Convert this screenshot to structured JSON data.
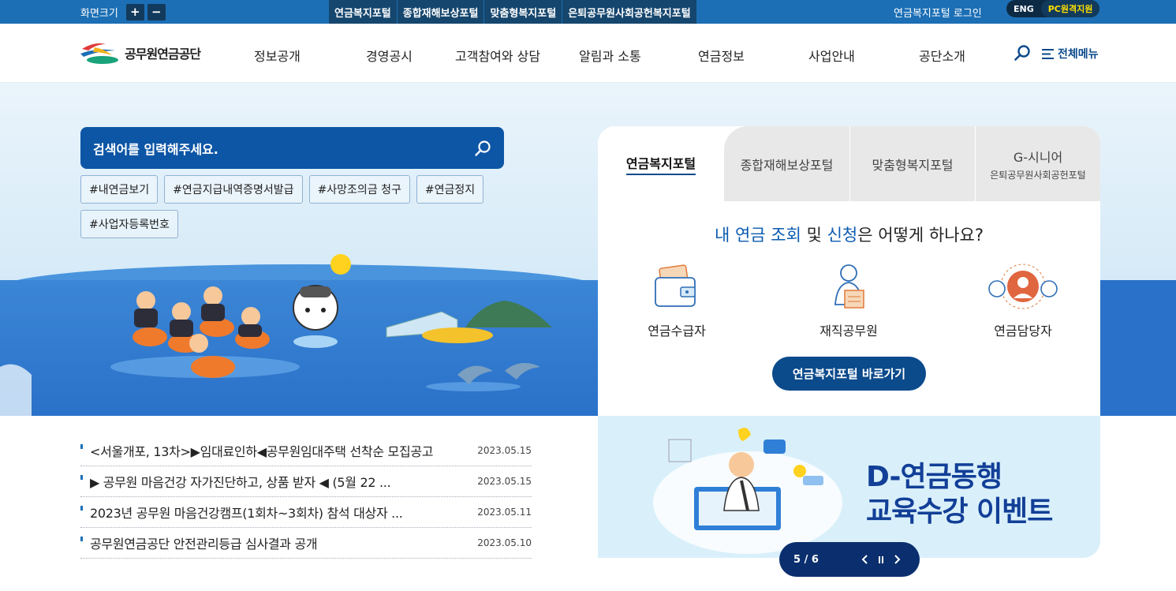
{
  "util": {
    "font_size_label": "화면크기",
    "plus": "+",
    "minus": "−",
    "portals": [
      "연금복지포털",
      "종합재해보상포털",
      "맞춤형복지포털",
      "은퇴공무원사회공헌복지포털"
    ],
    "login": "연금복지포털 로그인",
    "eng": "ENG",
    "pc": "PC원격지원"
  },
  "header": {
    "logo_text": "공무원연금공단",
    "nav": [
      "정보공개",
      "경영공시",
      "고객참여와 상담",
      "알림과 소통",
      "연금정보",
      "사업안내",
      "공단소개"
    ],
    "all_menu": "전체메뉴"
  },
  "hero": {
    "search_placeholder": "검색어를 입력해주세요.",
    "tags": [
      "#내연금보기",
      "#연금지급내역증명서발급",
      "#사망조의금 청구",
      "#연금정지",
      "#사업자등록번호"
    ]
  },
  "panel": {
    "tabs": [
      {
        "label": "연금복지포털",
        "sub": ""
      },
      {
        "label": "종합재해보상포털",
        "sub": ""
      },
      {
        "label": "맞춤형복지포털",
        "sub": ""
      },
      {
        "label": "G-시니어",
        "sub": "은퇴공무원사회공헌포털"
      }
    ],
    "question": {
      "p1": "내 연금 조회",
      "p2": " 및 ",
      "p3": "신청",
      "p4": "은 어떻게 하나요?"
    },
    "roles": [
      "연금수급자",
      "재직공무원",
      "연금담당자"
    ],
    "go_button": "연금복지포털 바로가기"
  },
  "news": [
    {
      "title": "<서울개포, 13차>▶임대료인하◀공무원임대주택 선착순 모집공고",
      "date": "2023.05.15"
    },
    {
      "title": "▶ 공무원 마음건강 자가진단하고, 상품 받자 ◀ (5월 22 ...",
      "date": "2023.05.15"
    },
    {
      "title": "2023년 공무원 마음건강캠프(1회차~3회차) 참석 대상자 ...",
      "date": "2023.05.11"
    },
    {
      "title": "공무원연금공단 안전관리등급 심사결과 공개",
      "date": "2023.05.10"
    }
  ],
  "banner": {
    "line1": "D-연금동행",
    "line2": "교육수강 이벤트",
    "page": "5 / 6"
  }
}
